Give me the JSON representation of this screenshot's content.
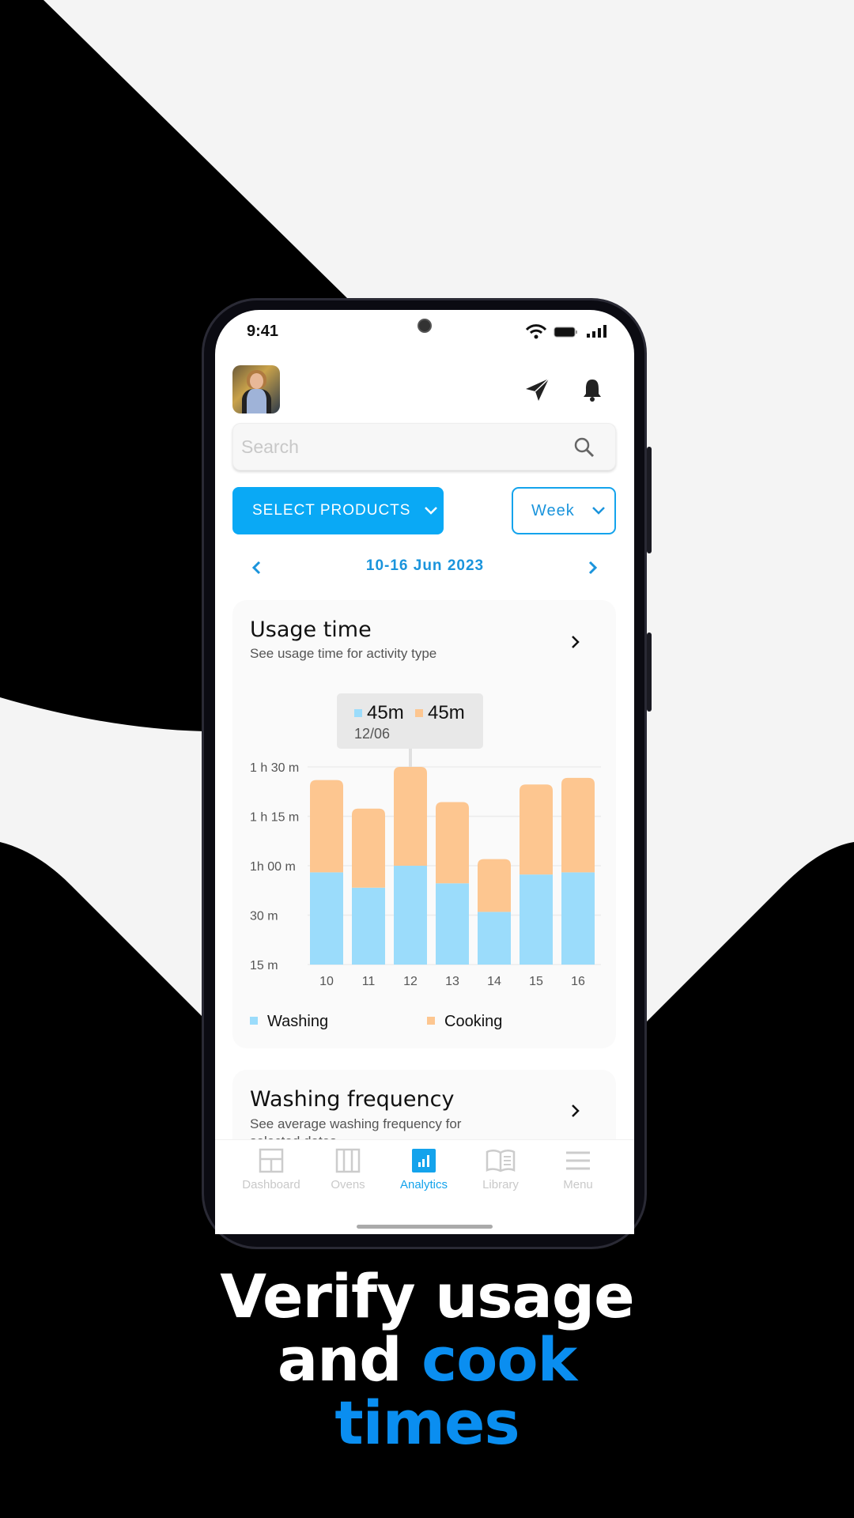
{
  "status_bar": {
    "time": "9:41"
  },
  "search": {
    "placeholder": "Search"
  },
  "filters": {
    "select_products": "SELECT PRODUCTS",
    "period": "Week"
  },
  "date_range": "10-16 Jun 2023",
  "usage_card": {
    "title": "Usage time",
    "subtitle": "See usage time for activity type",
    "tooltip": {
      "washing": "45m",
      "cooking": "45m",
      "date": "12/06"
    }
  },
  "chart_data": {
    "type": "bar",
    "stacked": true,
    "categories": [
      "10",
      "11",
      "12",
      "13",
      "14",
      "15",
      "16"
    ],
    "series": [
      {
        "name": "Washing",
        "color": "#9bdcfb",
        "values": [
          42,
          35,
          45,
          37,
          24,
          41,
          42
        ]
      },
      {
        "name": "Cooking",
        "color": "#fdc690",
        "values": [
          42,
          36,
          45,
          37,
          24,
          41,
          43
        ]
      }
    ],
    "ylim": [
      0,
      90
    ],
    "ytick_labels": [
      "15 m",
      "30 m",
      "1h 00 m",
      "1 h 15 m",
      "1 h 30 m"
    ],
    "grid": true,
    "legend": "bottom",
    "highlighted_category": "12"
  },
  "frequency_card": {
    "title": "Washing frequency",
    "subtitle": "See average washing frequency for selected dates"
  },
  "nav": {
    "items": [
      {
        "label": "Dashboard"
      },
      {
        "label": "Ovens"
      },
      {
        "label": "Analytics"
      },
      {
        "label": "Library"
      },
      {
        "label": "Menu"
      }
    ],
    "active": "Analytics"
  },
  "headline": {
    "line1": "Verify usage",
    "line2a": "and ",
    "line2b": "cook",
    "line3": "times"
  },
  "colors": {
    "accent": "#0aa9f5",
    "headline_blue": "#0a8ef0"
  }
}
